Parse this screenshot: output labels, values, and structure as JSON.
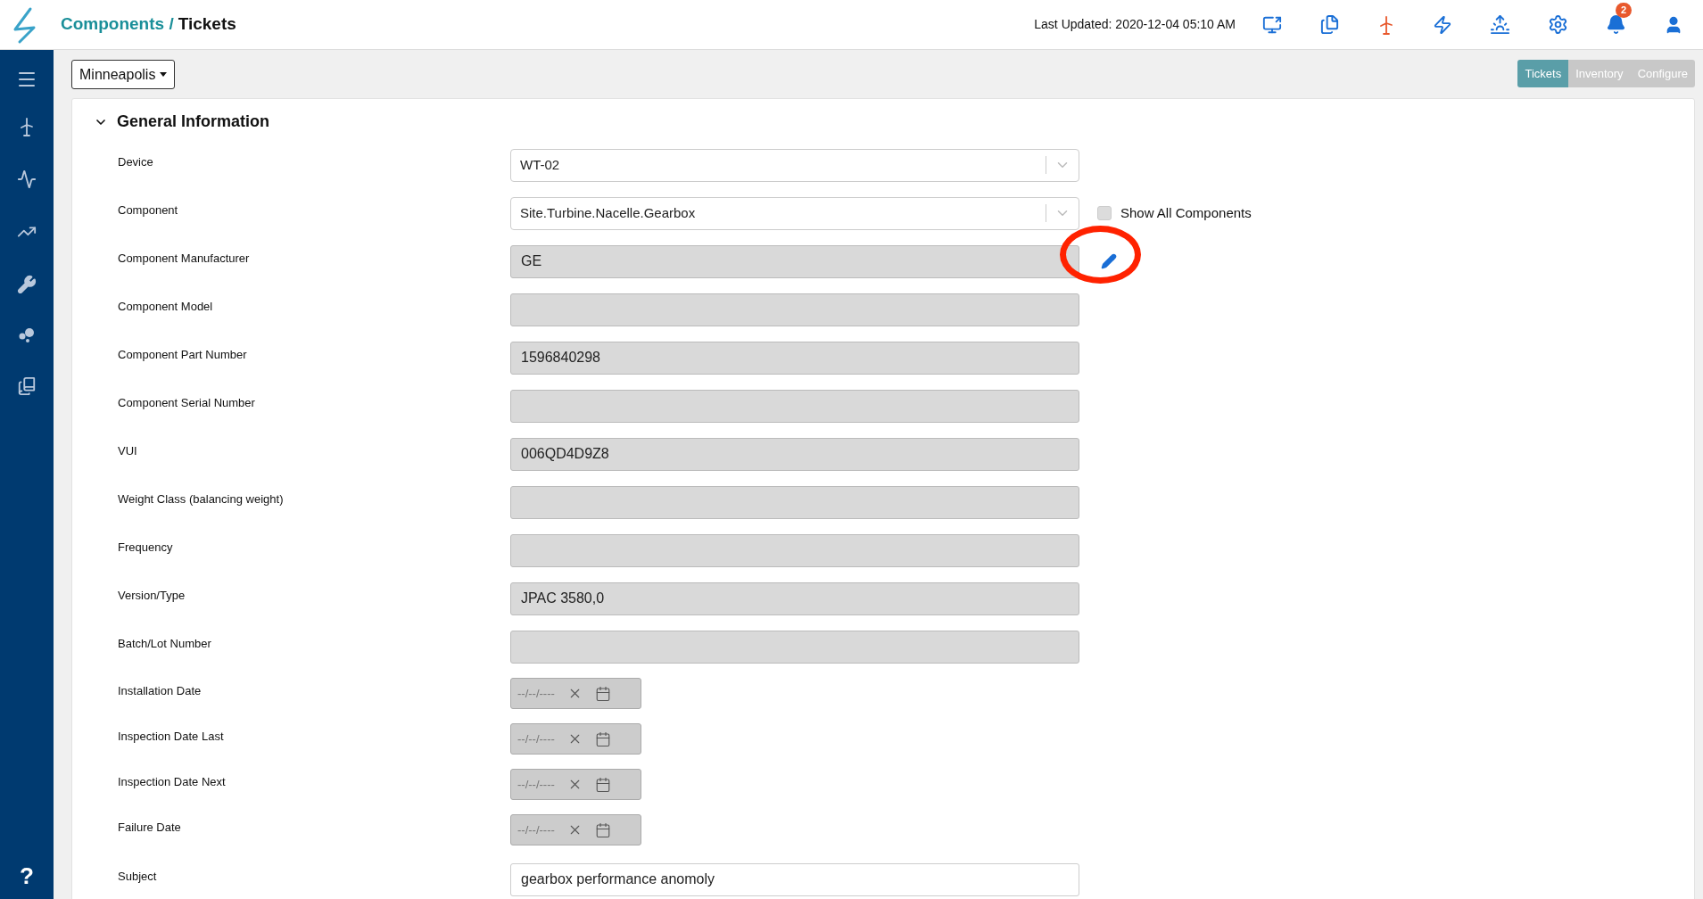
{
  "header": {
    "breadcrumb": [
      {
        "label": "Components /",
        "kind": "link"
      },
      {
        "label": "Tickets",
        "kind": "current"
      }
    ],
    "last_updated": "Last Updated: 2020-12-04 05:10 AM",
    "notification_count": "2"
  },
  "sidebar": {
    "help": "?"
  },
  "site_selector": {
    "label": "Minneapolis"
  },
  "view_tabs": [
    {
      "label": "Tickets",
      "selected": true
    },
    {
      "label": "Inventory",
      "selected": false
    },
    {
      "label": "Configure",
      "selected": false
    }
  ],
  "section": {
    "title": "General Information",
    "expanded": true,
    "fields": [
      {
        "label": "Device",
        "kind": "select",
        "value": "WT-02",
        "disabled": false
      },
      {
        "label": "Component",
        "kind": "select",
        "value": "Site.Turbine.Nacelle.Gearbox",
        "disabled": false,
        "checkbox": {
          "label": "Show All Components",
          "checked": false
        }
      },
      {
        "label": "Component Manufacturer",
        "kind": "input",
        "value": "GE",
        "disabled": true,
        "edit_button": true,
        "highlighted": true
      },
      {
        "label": "Component Model",
        "kind": "input",
        "disabled": true
      },
      {
        "label": "Component Part Number",
        "kind": "input",
        "value": "1596840298",
        "disabled": true
      },
      {
        "label": "Component Serial Number",
        "kind": "input",
        "disabled": true
      },
      {
        "label": "VUI",
        "kind": "input",
        "value": "006QD4D9Z8",
        "disabled": true
      },
      {
        "label": "Weight Class (balancing weight)",
        "kind": "input",
        "disabled": true
      },
      {
        "label": "Frequency",
        "kind": "input",
        "disabled": true
      },
      {
        "label": "Version/Type",
        "kind": "input",
        "value": "JPAC 3580,0",
        "disabled": true
      },
      {
        "label": "Batch/Lot Number",
        "kind": "input",
        "disabled": true
      },
      {
        "label": "Installation Date",
        "kind": "date",
        "placeholder": "--/--/----",
        "disabled": true
      },
      {
        "label": "Inspection Date Last",
        "kind": "date",
        "placeholder": "--/--/----",
        "disabled": true
      },
      {
        "label": "Inspection Date Next",
        "kind": "date",
        "placeholder": "--/--/----",
        "disabled": true
      },
      {
        "label": "Failure Date",
        "kind": "date",
        "placeholder": "--/--/----",
        "disabled": true
      },
      {
        "label": "Subject",
        "kind": "input",
        "value": "gearbox performance anomoly",
        "disabled": false
      }
    ]
  }
}
